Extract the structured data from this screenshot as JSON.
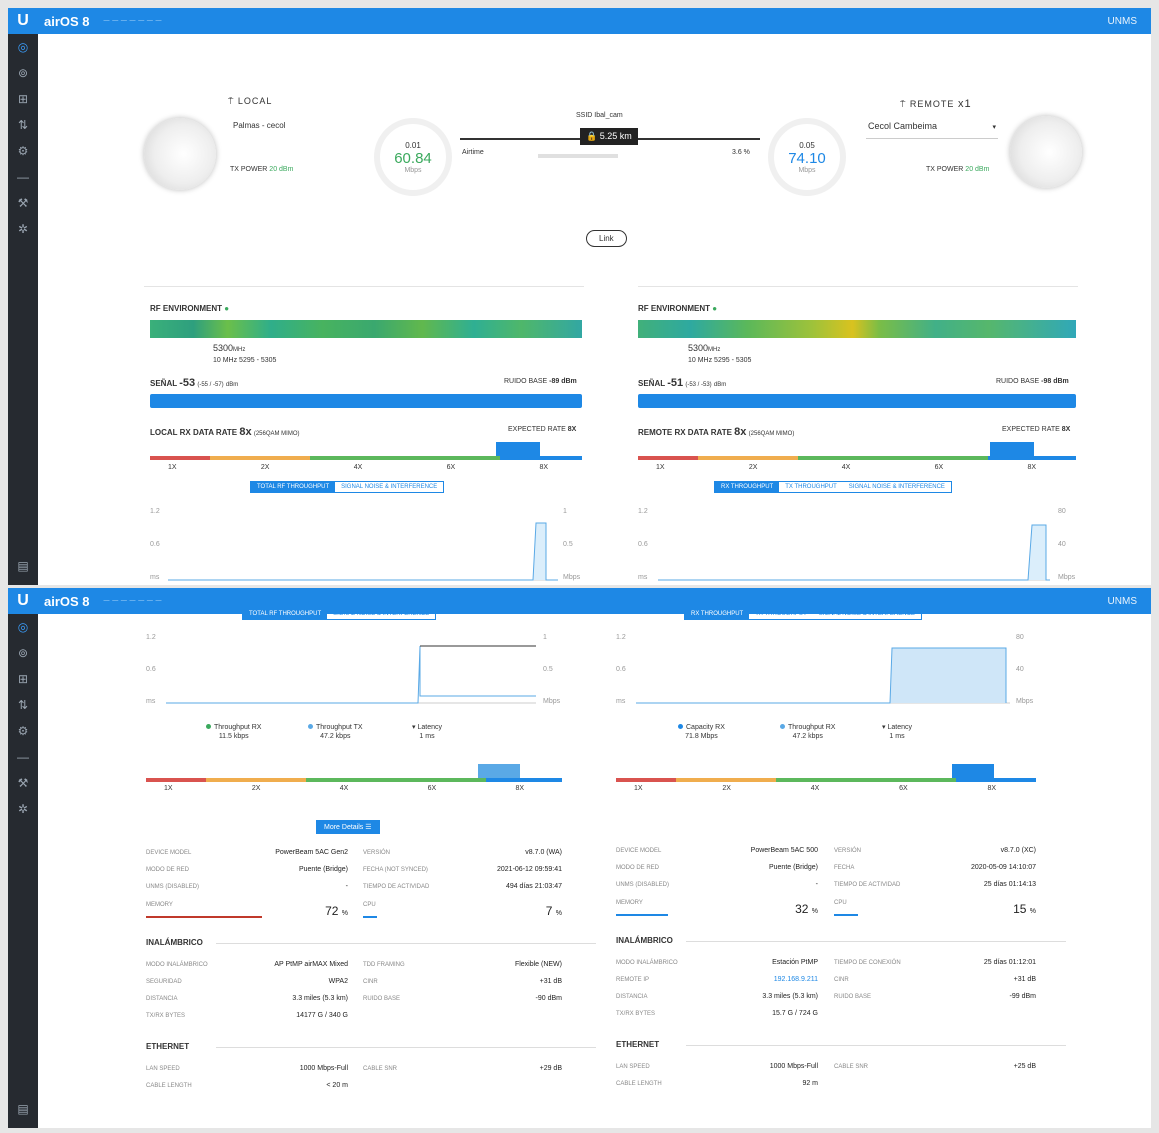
{
  "app": {
    "brand": "airOS 8",
    "unms": "UNMS"
  },
  "local": {
    "label": "LOCAL",
    "device_name": "Palmas - cecol",
    "tx_power_label": "TX POWER",
    "tx_power_value": "20 dBm",
    "gauge_top": "0.01",
    "gauge_value": "60.84",
    "gauge_unit": "Mbps"
  },
  "remote": {
    "label": "REMOTE",
    "count": "x1",
    "device_name": "Cecol Cambeima",
    "tx_power_label": "TX POWER",
    "tx_power_value": "20 dBm",
    "gauge_top": "0.05",
    "gauge_value": "74.10",
    "gauge_unit": "Mbps"
  },
  "link": {
    "ssid_label": "SSID",
    "ssid_value": "Ibal_cam",
    "distance": "5.25 km",
    "airtime_label": "Airtime",
    "airtime_value": "3.6 %",
    "tab": "Link"
  },
  "local_panel": {
    "rf_label": "RF ENVIRONMENT",
    "freq": "5300",
    "freq_unit": "MHz",
    "band": "10 MHz 5295 - 5305",
    "signal_label": "SEÑAL",
    "signal_value": "-53",
    "signal_detail": "(-55 / -57)",
    "signal_unit": "dBm",
    "noise_label": "RUIDO BASE",
    "noise_value": "-89 dBm",
    "rate_label": "LOCAL RX DATA RATE",
    "rate_value": "8x",
    "rate_mod": "(256QAM MIMO)",
    "expected_label": "EXPECTED RATE",
    "expected_value": "8X",
    "tabs": [
      "TOTAL RF THROUGHPUT",
      "SIGNAL NOISE & INTERFERENCE"
    ],
    "y_left": [
      "1.2",
      "0.6",
      "ms"
    ],
    "y_right": [
      "1",
      "0.5",
      "Mbps"
    ]
  },
  "remote_panel": {
    "rf_label": "RF ENVIRONMENT",
    "freq": "5300",
    "freq_unit": "MHz",
    "band": "10 MHz 5295 - 5305",
    "signal_label": "SEÑAL",
    "signal_value": "-51",
    "signal_detail": "(-53 / -53)",
    "signal_unit": "dBm",
    "noise_label": "RUIDO BASE",
    "noise_value": "-98 dBm",
    "rate_label": "REMOTE RX DATA RATE",
    "rate_value": "8x",
    "rate_mod": "(256QAM MIMO)",
    "expected_label": "EXPECTED RATE",
    "expected_value": "8X",
    "tabs": [
      "RX THROUGHPUT",
      "TX THROUGHPUT",
      "SIGNAL NOISE & INTERFERENCE"
    ],
    "y_left": [
      "1.2",
      "0.6",
      "ms"
    ],
    "y_right": [
      "80",
      "40",
      "Mbps"
    ]
  },
  "rate_ticks": [
    "1X",
    "2X",
    "4X",
    "6X",
    "8X"
  ],
  "bottom": {
    "legend_left": [
      {
        "name": "Throughput RX",
        "value": "11.5 kbps"
      },
      {
        "name": "Throughput TX",
        "value": "47.2 kbps"
      },
      {
        "name": "Latency",
        "value": "1 ms"
      }
    ],
    "legend_right": [
      {
        "name": "Capacity RX",
        "value": "71.8 Mbps"
      },
      {
        "name": "Throughput RX",
        "value": "47.2 kbps"
      },
      {
        "name": "Latency",
        "value": "1 ms"
      }
    ],
    "more_details": "More Details",
    "left": {
      "device_model_label": "DEVICE MODEL",
      "device_model": "PowerBeam 5AC Gen2",
      "version_label": "VERSIÓN",
      "version": "v8.7.0 (WA)",
      "net_mode_label": "MODO DE RED",
      "net_mode": "Puente (Bridge)",
      "date_label": "FECHA (NOT SYNCED)",
      "date": "2021-06-12 09:59:41",
      "unms_label": "UNMS (DISABLED)",
      "unms": "-",
      "uptime_label": "TIEMPO DE ACTIVIDAD",
      "uptime": "494 días 21:03:47",
      "memory_label": "MEMORY",
      "memory": "72",
      "cpu_label": "CPU",
      "cpu": "7",
      "pct": "%",
      "wireless_title": "INALÁMBRICO",
      "wmode_label": "MODO INALÁMBRICO",
      "wmode": "AP PtMP airMAX Mixed",
      "frame_label": "TDD FRAMING",
      "frame": "Flexible (NEW)",
      "sec_label": "SEGURIDAD",
      "sec": "WPA2",
      "cinr_label": "CINR",
      "cinr": "+31 dB",
      "dist_label": "DISTANCIA",
      "dist": "3.3 miles (5.3 km)",
      "noise_label": "RUIDO BASE",
      "noise": "-90 dBm",
      "txrx_label": "TX/RX BYTES",
      "txrx": "14177 G / 340 G",
      "eth_title": "ETHERNET",
      "lan_label": "LAN SPEED",
      "lan": "1000 Mbps-Full",
      "snr_label": "CABLE SNR",
      "snr": "+29 dB",
      "cable_label": "CABLE LENGTH",
      "cable": "< 20 m"
    },
    "right": {
      "device_model_label": "DEVICE MODEL",
      "device_model": "PowerBeam 5AC 500",
      "version_label": "VERSIÓN",
      "version": "v8.7.0 (XC)",
      "net_mode_label": "MODO DE RED",
      "net_mode": "Puente (Bridge)",
      "date_label": "FECHA",
      "date": "2020-05-09 14:10:07",
      "unms_label": "UNMS (DISABLED)",
      "unms": "-",
      "uptime_label": "TIEMPO DE ACTIVIDAD",
      "uptime": "25 días 01:14:13",
      "memory_label": "MEMORY",
      "memory": "32",
      "cpu_label": "CPU",
      "cpu": "15",
      "pct": "%",
      "wireless_title": "INALÁMBRICO",
      "wmode_label": "MODO INALÁMBRICO",
      "wmode": "Estación PtMP",
      "conn_label": "TIEMPO DE CONEXIÓN",
      "conn": "25 días 01:12:01",
      "rip_label": "REMOTE IP",
      "rip": "192.168.9.211",
      "cinr_label": "CINR",
      "cinr": "+31 dB",
      "dist_label": "DISTANCIA",
      "dist": "3.3 miles (5.3 km)",
      "noise_label": "RUIDO BASE",
      "noise": "-99 dBm",
      "txrx_label": "TX/RX BYTES",
      "txrx": "15.7 G / 724 G",
      "eth_title": "ETHERNET",
      "lan_label": "LAN SPEED",
      "lan": "1000 Mbps-Full",
      "snr_label": "CABLE SNR",
      "snr": "+25 dB",
      "cable_label": "CABLE LENGTH",
      "cable": "92 m"
    }
  }
}
